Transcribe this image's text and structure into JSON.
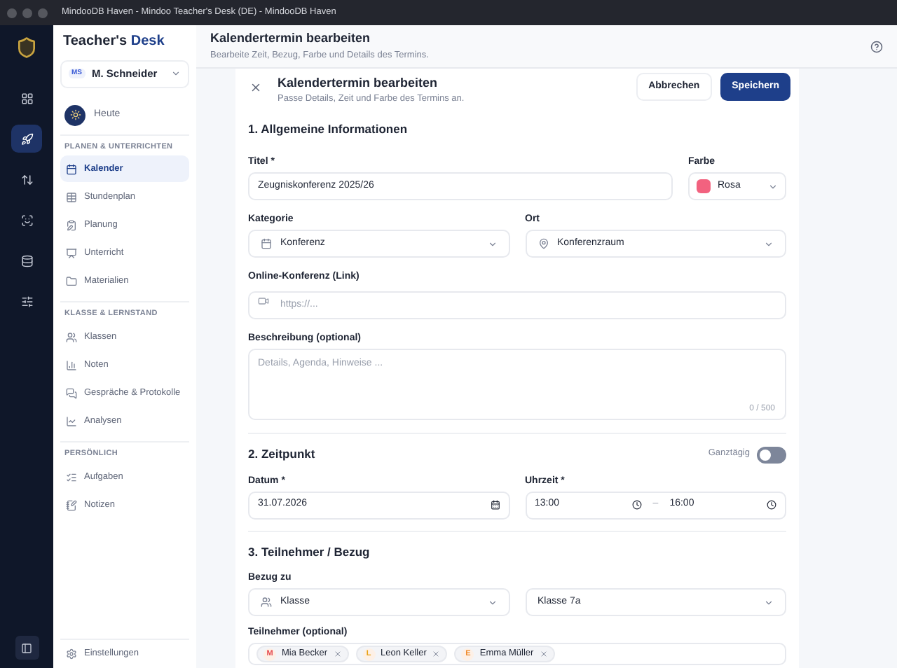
{
  "window": {
    "title": "MindooDB Haven - Mindoo Teacher's Desk (DE) - MindooDB Haven"
  },
  "rail": [
    {
      "selected": false
    },
    {
      "selected": true
    },
    {
      "selected": false
    },
    {
      "selected": false
    },
    {
      "selected": false
    },
    {
      "selected": false
    }
  ],
  "sidebar": {
    "brand": {
      "first": "Teacher's",
      "second": "Desk"
    },
    "user": {
      "initials": "MS",
      "name": "M. Schneider"
    },
    "today": {
      "label": "Heute"
    },
    "groups": [
      {
        "title": "PLANEN & UNTERRICHTEN",
        "items": [
          {
            "label": "Kalender",
            "selected": true
          },
          {
            "label": "Stundenplan",
            "selected": false
          },
          {
            "label": "Planung",
            "selected": false
          },
          {
            "label": "Unterricht",
            "selected": false
          },
          {
            "label": "Materialien",
            "selected": false
          }
        ]
      },
      {
        "title": "KLASSE & LERNSTAND",
        "items": [
          {
            "label": "Klassen",
            "selected": false
          },
          {
            "label": "Noten",
            "selected": false
          },
          {
            "label": "Gespräche & Protokolle",
            "selected": false
          },
          {
            "label": "Analysen",
            "selected": false
          }
        ]
      },
      {
        "title": "PERSÖNLICH",
        "items": [
          {
            "label": "Aufgaben",
            "selected": false
          },
          {
            "label": "Notizen",
            "selected": false
          }
        ]
      }
    ],
    "settings": {
      "label": "Einstellungen"
    }
  },
  "header": {
    "title": "Kalendertermin bearbeiten",
    "subtitle": "Bearbeite Zeit, Bezug, Farbe und Details des Termins."
  },
  "modal": {
    "title": "Kalendertermin bearbeiten",
    "subtitle": "Passe Details, Zeit und Farbe des Termins an.",
    "cancel": "Abbrechen",
    "save": "Speichern"
  },
  "general": {
    "heading": "1. Allgemeine Informationen",
    "title_field": {
      "label": "Titel *",
      "value": "Zeugniskonferenz 2025/26"
    },
    "color_field": {
      "label": "Farbe",
      "value": "Rosa",
      "color": "#f2627f"
    },
    "category": {
      "label": "Kategorie",
      "value": "Konferenz"
    },
    "location": {
      "label": "Ort",
      "value": "Konferenzraum"
    },
    "online": {
      "label": "Online-Konferenz (Link)",
      "placeholder": "https://..."
    },
    "description": {
      "label": "Beschreibung (optional)",
      "placeholder": "Details, Agenda, Hinweise ...",
      "counter": "0 / 500"
    }
  },
  "time": {
    "heading": "2. Zeitpunkt",
    "all_day": {
      "label": "Ganztägig",
      "on": false
    },
    "date": {
      "label": "Datum *",
      "value": "31.07.2026"
    },
    "time": {
      "label": "Uhrzeit *",
      "start": "13:00",
      "separator": "–",
      "end": "16:00"
    }
  },
  "participants": {
    "heading": "3. Teilnehmer / Bezug",
    "relation": {
      "label": "Bezug zu",
      "type": "Klasse",
      "target": "Klasse 7a"
    },
    "attendees": {
      "label": "Teilnehmer (optional)",
      "chips": [
        {
          "initial": "M",
          "name": "Mia Becker",
          "color": "#e5484d"
        },
        {
          "initial": "L",
          "name": "Leon Keller",
          "color": "#e8a317"
        },
        {
          "initial": "E",
          "name": "Emma Müller",
          "color": "#f08c2e"
        }
      ]
    }
  }
}
